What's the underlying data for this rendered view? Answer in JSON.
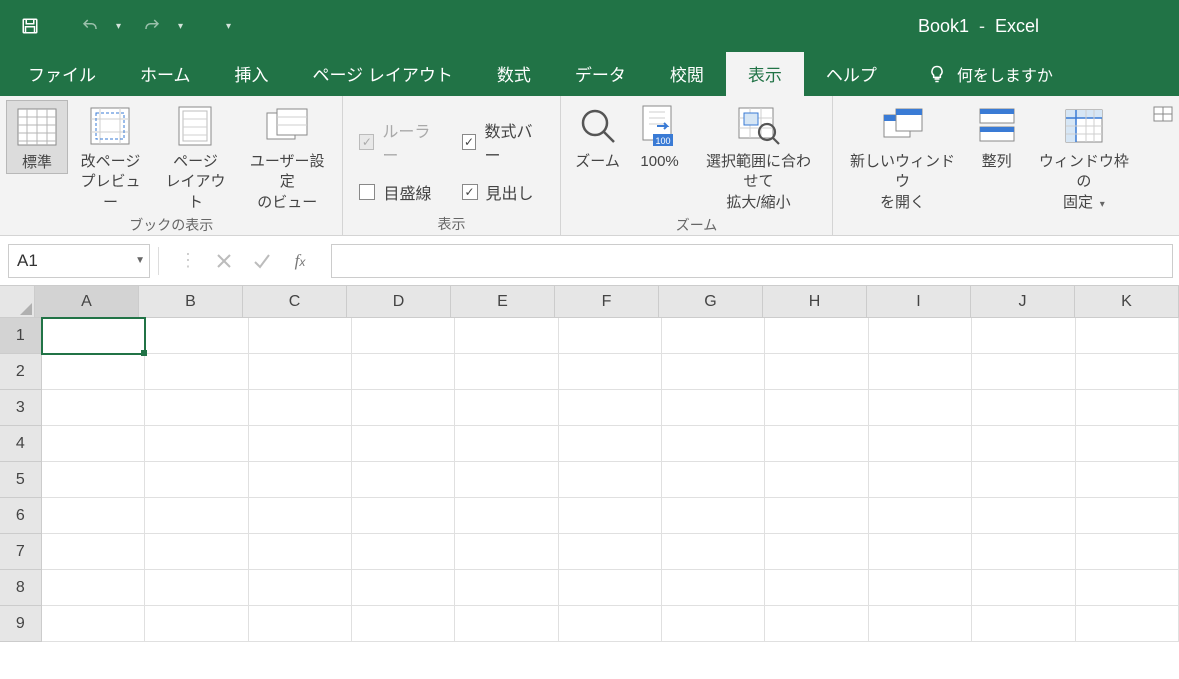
{
  "title": {
    "doc": "Book1",
    "sep": "-",
    "app": "Excel"
  },
  "tabs": {
    "items": [
      "ファイル",
      "ホーム",
      "挿入",
      "ページ レイアウト",
      "数式",
      "データ",
      "校閲",
      "表示",
      "ヘルプ"
    ],
    "active_index": 7,
    "tellme": "何をしますか"
  },
  "ribbon": {
    "group_views": {
      "label": "ブックの表示",
      "normal": "標準",
      "page_break": "改ページ\nプレビュー",
      "page_layout": "ページ\nレイアウト",
      "custom_views": "ユーザー設定\nのビュー"
    },
    "group_show": {
      "label": "表示",
      "ruler": "ルーラー",
      "formula_bar": "数式バー",
      "gridlines": "目盛線",
      "headings": "見出し"
    },
    "group_zoom": {
      "label": "ズーム",
      "zoom": "ズーム",
      "hundred": "100%",
      "fit": "選択範囲に合わせて\n拡大/縮小"
    },
    "group_window": {
      "new_window": "新しいウィンドウ\nを開く",
      "arrange": "整列",
      "freeze": "ウィンドウ枠の\n固定"
    }
  },
  "formula_bar": {
    "name_box": "A1"
  },
  "grid": {
    "columns": [
      "A",
      "B",
      "C",
      "D",
      "E",
      "F",
      "G",
      "H",
      "I",
      "J",
      "K"
    ],
    "rows": [
      "1",
      "2",
      "3",
      "4",
      "5",
      "6",
      "7",
      "8",
      "9"
    ],
    "active_cell": "A1"
  }
}
